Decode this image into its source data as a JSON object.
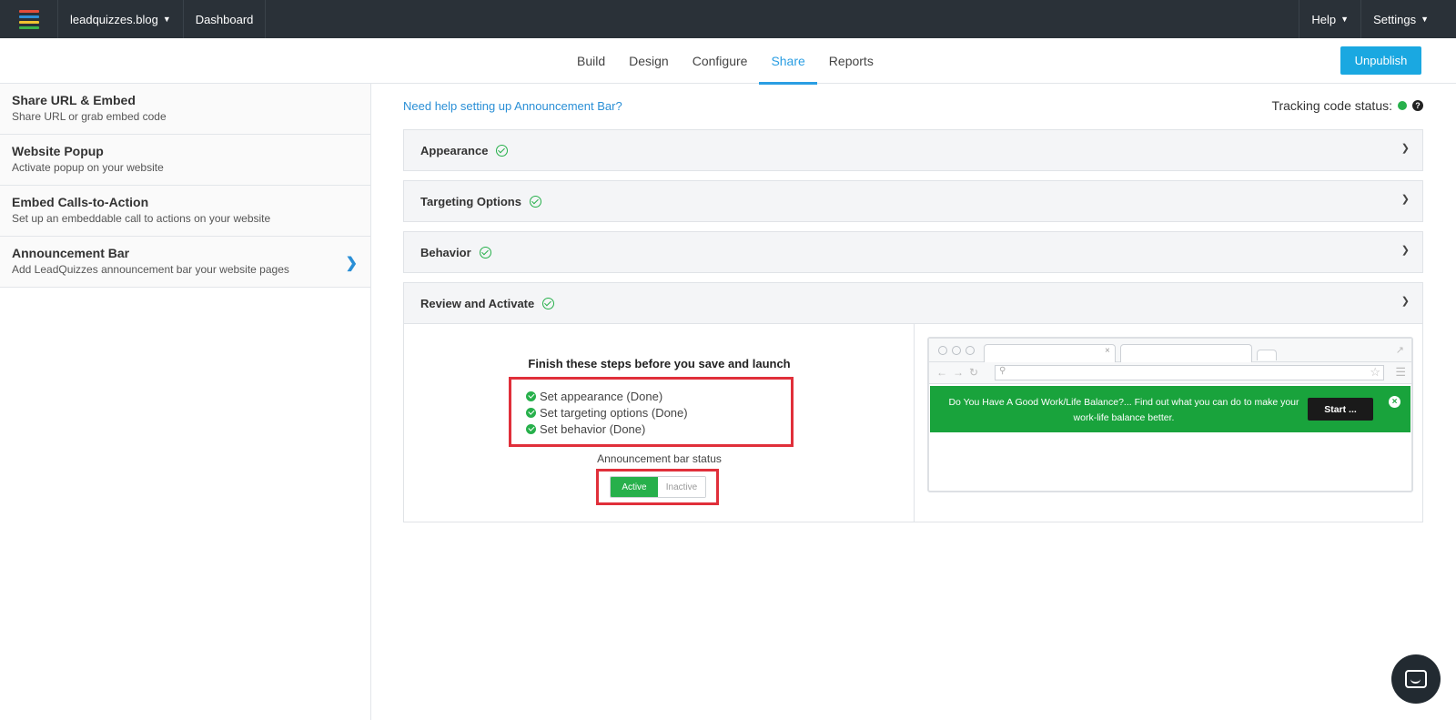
{
  "topbar": {
    "workspace": "leadquizzes.blog",
    "dashboard": "Dashboard",
    "help": "Help",
    "settings": "Settings",
    "logo_colors": [
      "#e44d3a",
      "#2f8fd6",
      "#f0c330",
      "#3cb54a"
    ]
  },
  "subnav": {
    "tabs": [
      {
        "label": "Build"
      },
      {
        "label": "Design"
      },
      {
        "label": "Configure"
      },
      {
        "label": "Share"
      },
      {
        "label": "Reports"
      }
    ],
    "active_tab": "Share",
    "unpublish": "Unpublish"
  },
  "sidebar": {
    "items": [
      {
        "title": "Share URL & Embed",
        "subtitle": "Share URL or grab embed code"
      },
      {
        "title": "Website Popup",
        "subtitle": "Activate popup on your website"
      },
      {
        "title": "Embed Calls-to-Action",
        "subtitle": "Set up an embeddable call to actions on your website"
      },
      {
        "title": "Announcement Bar",
        "subtitle": "Add LeadQuizzes announcement bar your website pages"
      }
    ]
  },
  "main": {
    "help_link": "Need help setting up Announcement Bar?",
    "tracking_label": "Tracking code status:",
    "panels": [
      {
        "title": "Appearance"
      },
      {
        "title": "Targeting Options"
      },
      {
        "title": "Behavior"
      },
      {
        "title": "Review and Activate"
      }
    ],
    "review": {
      "steps_title": "Finish these steps before you save and launch",
      "steps": [
        "Set appearance (Done)",
        "Set targeting options (Done)",
        "Set behavior (Done)"
      ],
      "status_label": "Announcement bar status",
      "active": "Active",
      "inactive": "Inactive"
    },
    "preview": {
      "bar_text": "Do You Have A Good Work/Life Balance?... Find out what you can do to make your work-life balance better.",
      "button": "Start ...",
      "bar_color": "#19a33c"
    }
  }
}
